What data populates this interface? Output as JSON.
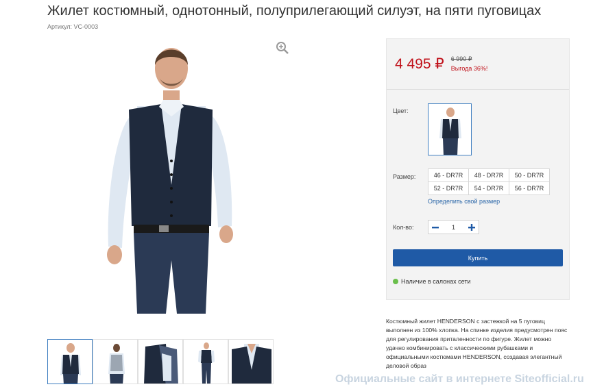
{
  "product": {
    "title": "Жилет костюмный, однотонный, полуприлегающий силуэт, на пяти пуговицах",
    "sku": "Артикул: VC-0003"
  },
  "price": {
    "current": "4 495",
    "currency": "₽",
    "old": "6 990 ₽",
    "discount": "Выгода 36%!"
  },
  "options": {
    "color_label": "Цвет:",
    "size_label": "Размер:",
    "sizes": [
      "46 - DR7R",
      "48 - DR7R",
      "50 - DR7R",
      "52 - DR7R",
      "54 - DR7R",
      "56 - DR7R"
    ],
    "size_link": "Определить свой размер",
    "qty_label": "Кол-во:",
    "qty_value": "1"
  },
  "actions": {
    "buy_label": "Купить",
    "availability": "Наличие в салонах сети"
  },
  "description": "Костюмный жилет HENDERSON с застежкой на 5 пуговиц выполнен из 100% хлопка. На спинке изделия предусмотрен пояс для регулирования приталенности по фигуре. Жилет можно удачно комбинировать с классическими рубашками и официальными костюмами HENDERSON, создавая элегантный деловой образ",
  "watermark": "Официальные сайт в интернете Siteofficial.ru",
  "colors": {
    "accent": "#1f5aa6",
    "price_red": "#c0111a",
    "available": "#6abf4b"
  },
  "icons": {
    "zoom": "zoom-in-icon",
    "minus": "minus-icon",
    "plus": "plus-icon"
  }
}
